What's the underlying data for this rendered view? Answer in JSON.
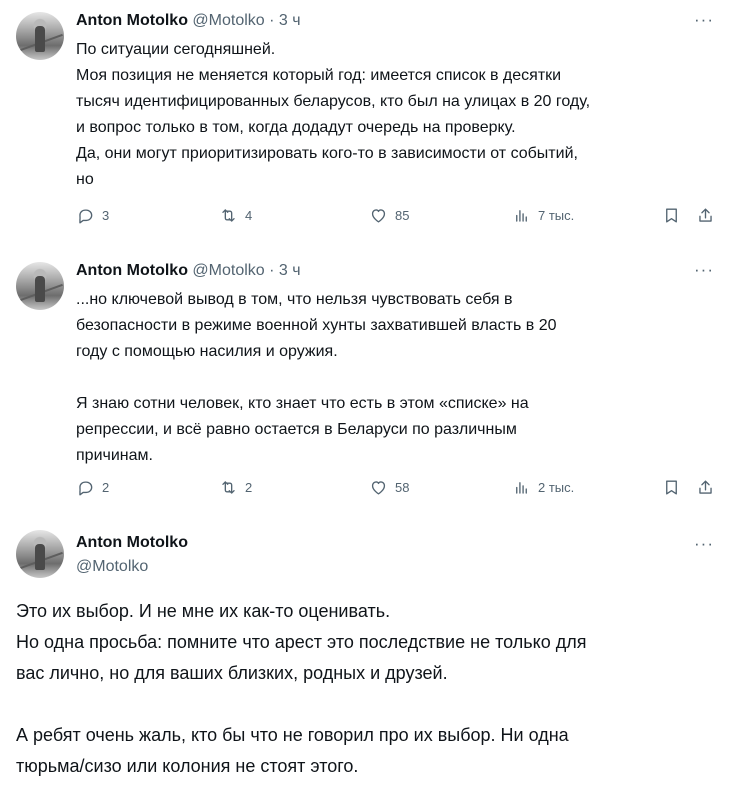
{
  "tweets": [
    {
      "name": "Anton Motolko",
      "handle": "@Motolko",
      "dot": "·",
      "time": "3 ч",
      "more": "···",
      "text": "По ситуации сегодняшней.\nМоя позиция не меняется который год: имеется список в десятки\nтысяч идентифицированных беларусов, кто был на улицах в 20 году,\nи вопрос только в том, когда додадут очередь на проверку.\nДа, они могут приоритизировать кого-то в зависимости от событий,\nно",
      "replies": "3",
      "reposts": "4",
      "likes": "85",
      "views": "7 тыс."
    },
    {
      "name": "Anton Motolko",
      "handle": "@Motolko",
      "dot": "·",
      "time": "3 ч",
      "more": "···",
      "text": "...но ключевой вывод в том, что нельзя чувствовать себя в\nбезопасности в режиме военной хунты захватившей власть в 20\nгоду с помощью насилия и оружия.\n\nЯ знаю сотни человек, кто знает что есть в этом «списке» на\nрепрессии, и всё равно остается в Беларуси по различным\nпричинам.",
      "replies": "2",
      "reposts": "2",
      "likes": "58",
      "views": "2 тыс."
    }
  ],
  "main_tweet": {
    "name": "Anton Motolko",
    "handle": "@Motolko",
    "more": "···",
    "text": "Это их выбор. И не мне их как-то оценивать.\nНо одна просьба: помните что арест это последствие не только для\nвас лично, но для ваших близких, родных и друзей.\n\nА ребят очень жаль, кто бы что не говорил про их выбор. Ни одна\nтюрьма/сизо или колония не стоят этого."
  },
  "icons": {
    "reply": "reply-icon",
    "repost": "repost-icon",
    "like": "like-icon",
    "views": "views-icon",
    "bookmark": "bookmark-icon",
    "share": "share-icon"
  },
  "colors": {
    "text": "#0f1419",
    "secondary": "#536471"
  }
}
